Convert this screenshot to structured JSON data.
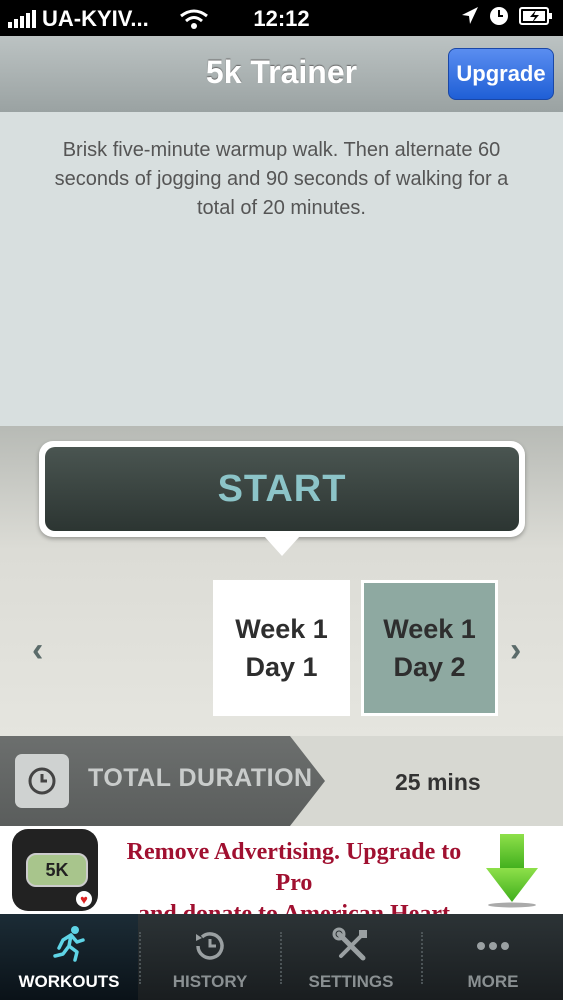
{
  "status_bar": {
    "carrier": "UA-KYIV...",
    "time": "12:12"
  },
  "navbar": {
    "title": "5k Trainer",
    "upgrade_label": "Upgrade"
  },
  "workout": {
    "description": "Brisk five-minute warmup walk. Then alternate 60 seconds of jogging and 90 seconds of walking for a total of 20 minutes.",
    "start_label": "START",
    "prev_arrow": "‹",
    "next_arrow": "›",
    "days": [
      {
        "week": "Week 1",
        "day": "Day 1",
        "selected": true
      },
      {
        "week": "Week 1",
        "day": "Day 2",
        "selected": false
      }
    ],
    "total_duration_label": "TOTAL DURATION",
    "total_duration_value": "25 mins"
  },
  "ad": {
    "icon_text": "5K",
    "line1": "Remove Advertising. Upgrade to Pro",
    "line2": "and donate to American Heart today!"
  },
  "tabs": [
    {
      "label": "WORKOUTS",
      "icon": "runner-icon",
      "active": true
    },
    {
      "label": "HISTORY",
      "icon": "history-clock-icon",
      "active": false
    },
    {
      "label": "SETTINGS",
      "icon": "tools-icon",
      "active": false
    },
    {
      "label": "MORE",
      "icon": "more-dots-icon",
      "active": false
    }
  ],
  "colors": {
    "navbar": "#a9b0b0",
    "upgrade_button": "#2f6ee0",
    "start_text": "#8cc4c8",
    "selected_day": "#8ea9a1",
    "ad_text": "#a01030",
    "tab_active": "#ffffff"
  }
}
